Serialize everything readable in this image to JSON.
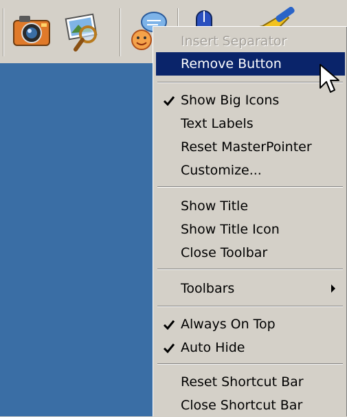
{
  "toolbar": {
    "buttons": [
      {
        "icon": "camera-icon"
      },
      {
        "icon": "image-search-icon"
      },
      {
        "icon": "user-chat-icon"
      },
      {
        "icon": "mouse-icon"
      },
      {
        "icon": "paint-brush-icon"
      }
    ]
  },
  "context_menu": {
    "items": [
      {
        "label": "Insert Separator",
        "state": "disabled"
      },
      {
        "label": "Remove Button",
        "state": "highlighted"
      },
      {
        "label": "Show Big Icons",
        "checked": true
      },
      {
        "label": "Text Labels"
      },
      {
        "label": "Reset MasterPointer"
      },
      {
        "label": "Customize..."
      },
      {
        "label": "Show Title"
      },
      {
        "label": "Show Title Icon"
      },
      {
        "label": "Close Toolbar"
      },
      {
        "label": "Toolbars",
        "submenu": true
      },
      {
        "label": "Always On Top",
        "checked": true
      },
      {
        "label": "Auto Hide",
        "checked": true
      },
      {
        "label": "Reset Shortcut Bar"
      },
      {
        "label": "Close Shortcut Bar"
      }
    ]
  },
  "colors": {
    "menu_bg": "#d4d0c8",
    "highlight": "#0a246a",
    "desktop": "#3a6ea5"
  }
}
